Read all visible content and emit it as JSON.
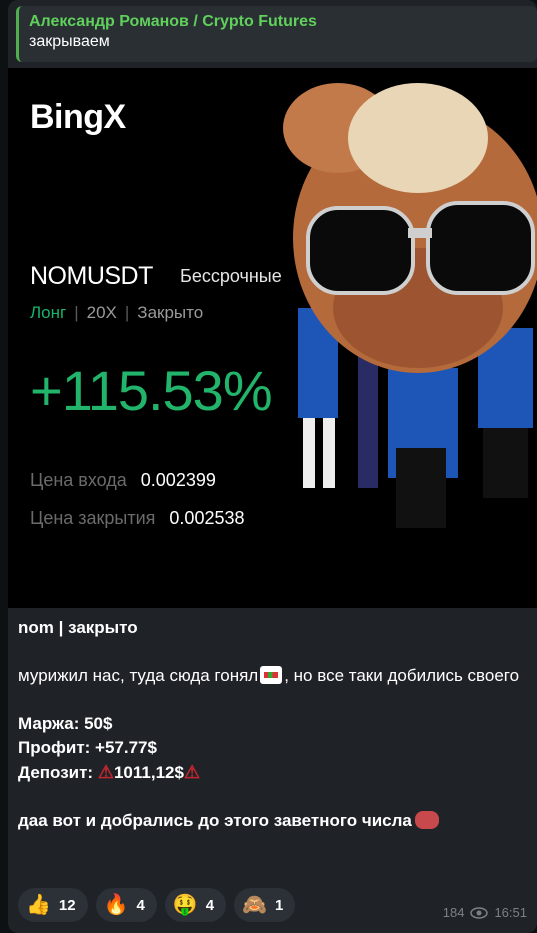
{
  "reply": {
    "author": "Александр Романов / Crypto Futures",
    "text": "закрываем"
  },
  "card": {
    "brand": "BingX",
    "pair": "NOMUSDT",
    "pair_type": "Бессрочные",
    "side": "Лонг",
    "leverage": "20X",
    "status": "Закрыто",
    "pnl": "+115.53%",
    "entry_label": "Цена входа",
    "entry_value": "0.002399",
    "close_label": "Цена закрытия",
    "close_value": "0.002538"
  },
  "message": {
    "title": "nom | закрыто",
    "line1_a": "мурижил нас, туда сюда гонял",
    "line1_b": ", но все таки добились своего",
    "margin": "Маржа: 50$",
    "profit": "Профит: +57.77$",
    "deposit_label": "Депозит:",
    "deposit_value": "1011,12$",
    "final_line": "даа вот и добрались до этого заветного числа"
  },
  "reactions": [
    {
      "icon": "thumbs-up-icon",
      "glyph": "👍",
      "count": "12"
    },
    {
      "icon": "fire-icon",
      "glyph": "🔥",
      "count": "4"
    },
    {
      "icon": "money-icon",
      "glyph": "🤑",
      "count": "4"
    },
    {
      "icon": "monkey-icon",
      "glyph": "🙈",
      "count": "1"
    }
  ],
  "footer": {
    "views": "184",
    "time": "16:51"
  },
  "colors": {
    "accent_green": "#21b46a",
    "author_green": "#5fd15b",
    "background": "#1f2327"
  }
}
